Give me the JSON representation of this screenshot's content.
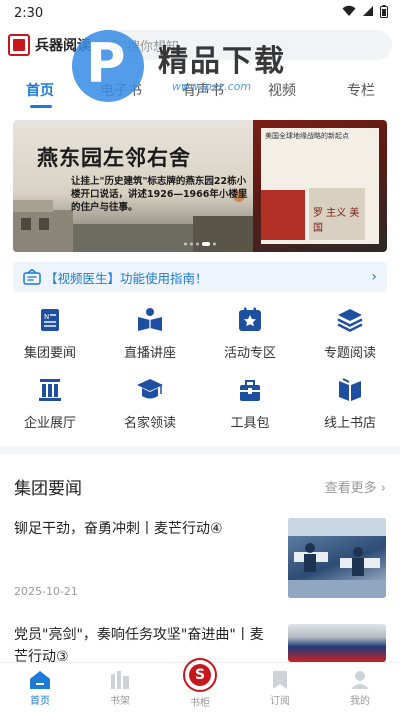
{
  "status_bar": {
    "time": "2:30"
  },
  "header": {
    "app_name": "兵器阅读",
    "search_placeholder": "搜你想知"
  },
  "watermark": {
    "text": "精品下载",
    "url": "www.jpxz.com"
  },
  "tabs": [
    {
      "label": "首页",
      "active": true
    },
    {
      "label": "电子书",
      "active": false
    },
    {
      "label": "有声书",
      "active": false
    },
    {
      "label": "视频",
      "active": false
    },
    {
      "label": "专栏",
      "active": false
    }
  ],
  "banner": {
    "title": "燕东园左邻右舍",
    "subtitle": "让挂上\"历史建筑\"标志牌的燕东园22栋小楼开口说话，讲述1926—1966年小楼里的住户与往事。",
    "right_top_text": "美国全球地缘战略的新起点",
    "right_book_text": "罗 主义 美国"
  },
  "notice": {
    "text": "【视频医生】功能使用指南！"
  },
  "grid": [
    {
      "label": "集团要闻",
      "icon": "news-icon"
    },
    {
      "label": "直播讲座",
      "icon": "lecture-icon"
    },
    {
      "label": "活动专区",
      "icon": "star-icon"
    },
    {
      "label": "专题阅读",
      "icon": "layers-icon"
    },
    {
      "label": "企业展厅",
      "icon": "building-icon"
    },
    {
      "label": "名家领读",
      "icon": "graduation-cap-icon"
    },
    {
      "label": "工具包",
      "icon": "toolbox-icon"
    },
    {
      "label": "线上书店",
      "icon": "bookstore-icon"
    }
  ],
  "news": {
    "section_title": "集团要闻",
    "more_label": "查看更多",
    "items": [
      {
        "headline": "铆足干劲，奋勇冲刺丨麦芒行动④",
        "date": "2025-10-21"
      },
      {
        "headline": "党员\"亮剑\"，奏响任务攻坚\"奋进曲\"丨麦芒行动③",
        "date": ""
      }
    ]
  },
  "bottom_nav": [
    {
      "label": "首页",
      "active": true
    },
    {
      "label": "书架",
      "active": false
    },
    {
      "label": "书柜",
      "active": false
    },
    {
      "label": "订阅",
      "active": false
    },
    {
      "label": "我的",
      "active": false
    }
  ],
  "colors": {
    "accent": "#1e7ad8",
    "brand_red": "#c8161d"
  }
}
